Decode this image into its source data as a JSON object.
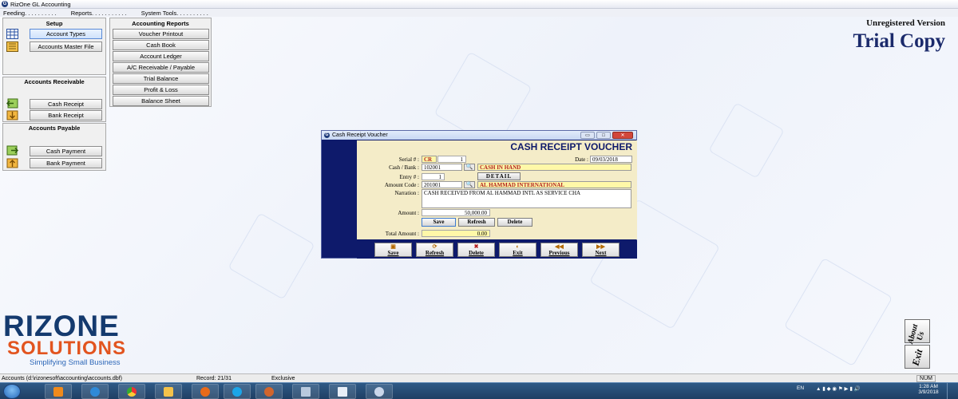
{
  "window": {
    "title": "RizOne GL Accounting",
    "app_icon": "G"
  },
  "menu": [
    "Feeding. . . . . . . . . .",
    "Reports. . . . . . . . . . .",
    "System Tools. . . . . . . . . ."
  ],
  "setup": {
    "title": "Setup",
    "buttons": [
      "Account Types",
      "Accounts Master File"
    ]
  },
  "reports": {
    "title": "Accounting Reports",
    "buttons": [
      "Voucher Printout",
      "Cash Book",
      "Account Ledger",
      "A/C Receivable / Payable",
      "Trial Balance",
      "Profit & Loss",
      "Balance Sheet"
    ]
  },
  "receivable": {
    "title": "Accounts Receivable",
    "buttons": [
      "Cash Receipt",
      "Bank Receipt"
    ]
  },
  "payable": {
    "title": "Accounts Payable",
    "buttons": [
      "Cash Payment",
      "Bank Payment"
    ]
  },
  "banner": {
    "unregistered": "Unregistered Version",
    "trial": "Trial Copy"
  },
  "dialog": {
    "title": "Cash Receipt Voucher",
    "heading": "CASH RECEIPT VOUCHER",
    "labels": {
      "serial": "Serial # :",
      "date": "Date :",
      "cash_bank": "Cash / Bank :",
      "entry": "Entry # :",
      "detail": "DETAIL",
      "amount_code": "Amount Code :",
      "narration": "Narration :",
      "amount": "Amount :",
      "total": "Total Amount :"
    },
    "values": {
      "serial_type": "CR",
      "serial_no": "1",
      "date": "09/03/2018",
      "cash_bank_code": "102001",
      "cash_bank_name": "CASH IN HAND",
      "entry_no": "1",
      "amount_code": "201001",
      "amount_name": "AL HAMMAD INTERNATIONAL",
      "narration": "CASH RECEIVED FROM AL HAMMAD INTL AS SERVICE CHA",
      "amount": "50,000.00",
      "total": "0.00"
    },
    "entry_buttons": [
      "Save",
      "Refresh",
      "Delete"
    ],
    "toolbar": [
      "Save",
      "Refresh",
      "Delete",
      "Exit",
      "Previous",
      "Next"
    ],
    "search_glyph": "🔍"
  },
  "logo": {
    "line1": "RIZONE",
    "line2": "SOLUTIONS",
    "tagline": "Simplifying Small Business"
  },
  "side_buttons": {
    "about": "About Us",
    "exit": "Exit"
  },
  "status": {
    "path": "Accounts (d:\\rizonesoft\\accounting\\accounts.dbf)",
    "record": "Record: 21/31",
    "mode": "Exclusive",
    "num": "NUM"
  },
  "tray": {
    "lang": "EN",
    "time": "1:28 AM",
    "date": "3/9/2018"
  },
  "colors": {
    "navy": "#0e1a6b",
    "form_bg": "#f4ecc8",
    "highlight_field": "#fff8a8",
    "brand_orange": "#e2541f",
    "brand_blue": "#143a6e"
  }
}
